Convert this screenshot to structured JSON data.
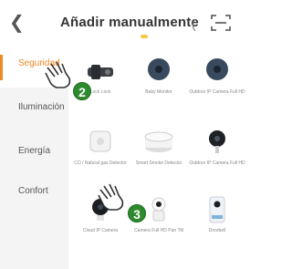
{
  "header": {
    "back_icon": "chevron-left-icon",
    "title": "Añadir manualmente",
    "separator": "(",
    "scan_icon": "scan-icon"
  },
  "sidebar": {
    "items": [
      {
        "label": "Seguridad",
        "active": true
      },
      {
        "label": "Iluminación",
        "active": false
      },
      {
        "label": "Energía",
        "active": false
      },
      {
        "label": "Confort",
        "active": false
      }
    ]
  },
  "devices": [
    {
      "label": "Lock Lock",
      "icon": "smart-lock-icon"
    },
    {
      "label": "Baby Monitor",
      "icon": "baby-monitor-icon"
    },
    {
      "label": "Outdoor IP Camera Full HD",
      "icon": "outdoor-camera-icon"
    },
    {
      "label": "CO / Natural gas Detector",
      "icon": "gas-detector-icon"
    },
    {
      "label": "Smart Smoke Detector",
      "icon": "smoke-detector-icon"
    },
    {
      "label": "Outdoor IP Camera Full HD",
      "icon": "outdoor-camera-icon"
    },
    {
      "label": "Cloud IP Camera",
      "icon": "indoor-camera-icon"
    },
    {
      "label": "Camera Full HD Pan Tilt",
      "icon": "pan-tilt-camera-icon"
    },
    {
      "label": "Doorbell",
      "icon": "doorbell-camera-icon"
    }
  ],
  "steps": [
    {
      "number": "2"
    },
    {
      "number": "3"
    }
  ],
  "colors": {
    "accent": "#f08a24",
    "step_badge": "#2f8a2f"
  }
}
